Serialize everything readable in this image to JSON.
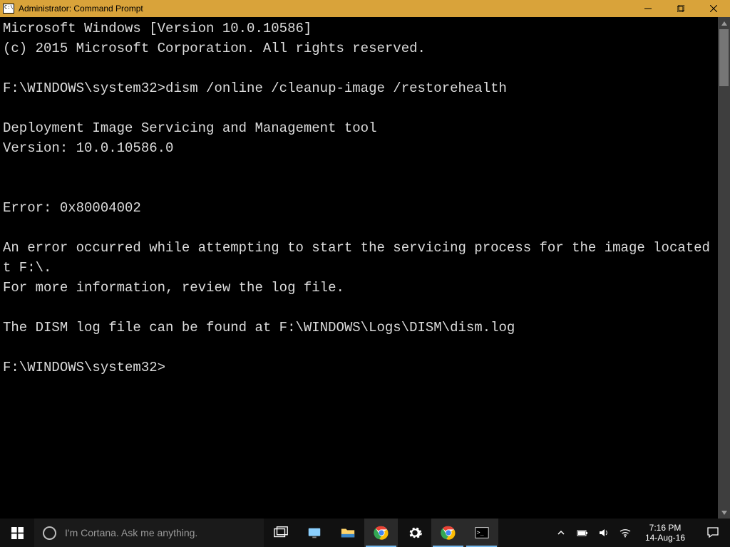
{
  "window": {
    "title": "Administrator: Command Prompt"
  },
  "console": {
    "lines": [
      "Microsoft Windows [Version 10.0.10586]",
      "(c) 2015 Microsoft Corporation. All rights reserved.",
      "",
      "F:\\WINDOWS\\system32>dism /online /cleanup-image /restorehealth",
      "",
      "Deployment Image Servicing and Management tool",
      "Version: 10.0.10586.0",
      "",
      "",
      "Error: 0x80004002",
      "",
      "An error occurred while attempting to start the servicing process for the image located at F:\\.",
      "For more information, review the log file.",
      "",
      "The DISM log file can be found at F:\\WINDOWS\\Logs\\DISM\\dism.log",
      "",
      "F:\\WINDOWS\\system32>"
    ]
  },
  "taskbar": {
    "cortana_placeholder": "I'm Cortana. Ask me anything.",
    "clock_time": "7:16 PM",
    "clock_date": "14-Aug-16"
  }
}
